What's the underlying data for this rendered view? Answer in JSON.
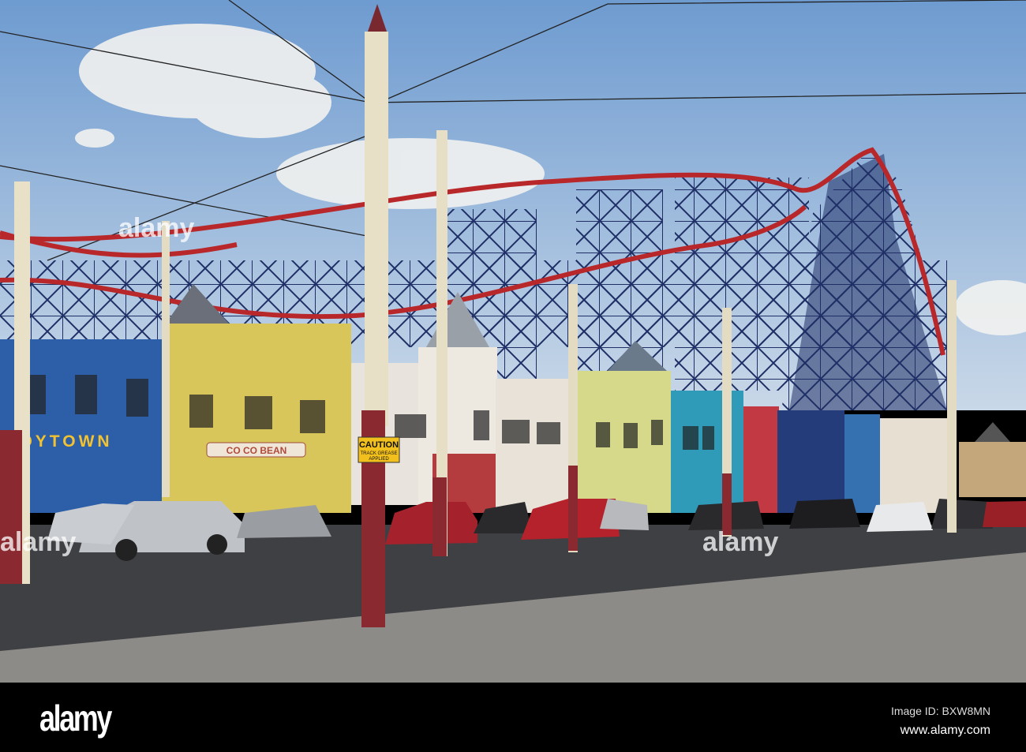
{
  "photo": {
    "signs": {
      "toytown": "TOYTOWN",
      "cafe": "CO CO BEAN",
      "caution_title": "CAUTION",
      "caution_line1": "TRACK GREASE",
      "caution_line2": "APPLIED"
    },
    "colors": {
      "sky": "#8fb4dc",
      "track": "#b8282a",
      "lattice": "#1f2f66",
      "road": "#3f4043",
      "pavement": "#8d8b88"
    }
  },
  "watermark": {
    "text": "alamy"
  },
  "footer": {
    "logo": "alamy",
    "image_id": "Image ID: BXW8MN",
    "url": "www.alamy.com"
  }
}
